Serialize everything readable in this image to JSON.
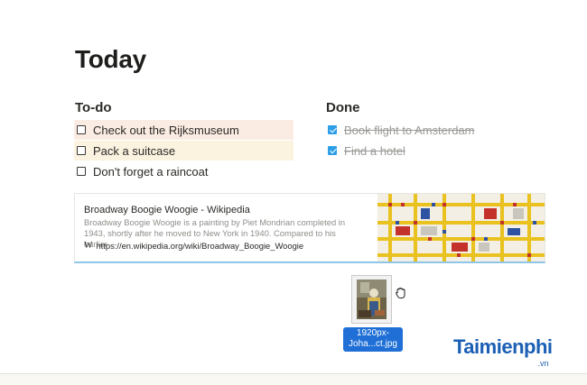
{
  "page": {
    "title": "Today"
  },
  "todo": {
    "title": "To-do",
    "items": [
      {
        "label": "Check out the Rijksmuseum",
        "checked": false,
        "highlight": "#fbece3"
      },
      {
        "label": "Pack a suitcase",
        "checked": false,
        "highlight": "#fbf2e0"
      },
      {
        "label": "Don't forget a raincoat",
        "checked": false,
        "highlight": ""
      }
    ]
  },
  "done": {
    "title": "Done",
    "items": [
      {
        "label": "Book flight to Amsterdam",
        "checked": true
      },
      {
        "label": "Find a hotel",
        "checked": true
      }
    ]
  },
  "bookmark": {
    "title": "Broadway Boogie Woogie - Wikipedia",
    "description": "Broadway Boogie Woogie is a painting by Piet Mondrian completed in 1943, shortly after he moved to New York in 1940. Compared to his earlier",
    "url": "https://en.wikipedia.org/wiki/Broadway_Boogie_Woogie",
    "favicon": "W",
    "accent": "#8fc6ea"
  },
  "file": {
    "name_line1": "1920px-",
    "name_line2": "Joha...ct.jpg"
  },
  "watermark": {
    "text": "Taimienphi",
    "sub": ".vn"
  },
  "colors": {
    "checkbox_checked": "#2e9fe6",
    "selection": "#1f6fd6"
  }
}
